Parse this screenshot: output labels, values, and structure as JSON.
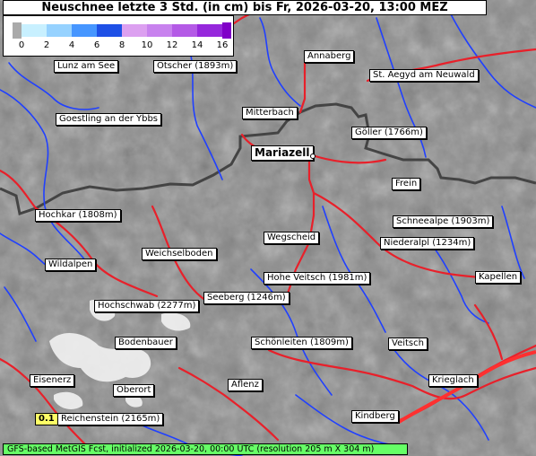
{
  "title": "Neuschnee letzte 3 Std. (in cm) bis Fr, 2026-03-20, 13:00 MEZ",
  "legend": {
    "ticks": [
      "0",
      "2",
      "4",
      "6",
      "8",
      "10",
      "12",
      "14",
      "16"
    ],
    "colors": [
      "#ffffff",
      "#c8f0ff",
      "#96d2ff",
      "#4696ff",
      "#1e50e6",
      "#dca0f0",
      "#c882ee",
      "#b45ae6",
      "#9628dc"
    ],
    "below_color": "#aaaaaa",
    "above_color": "#8000c8"
  },
  "places": [
    {
      "id": "annaberg",
      "name": "Annaberg"
    },
    {
      "id": "st-aegyd",
      "name": "St. Aegyd am Neuwald"
    },
    {
      "id": "lunz",
      "name": "Lunz am See"
    },
    {
      "id": "oetscher",
      "name": "Ötscher (1893m)"
    },
    {
      "id": "goestling",
      "name": "Goestling an der Ybbs"
    },
    {
      "id": "mitterbach",
      "name": "Mitterbach"
    },
    {
      "id": "goeller",
      "name": "Göller (1766m)"
    },
    {
      "id": "mariazell",
      "name": "Mariazell"
    },
    {
      "id": "frein",
      "name": "Frein"
    },
    {
      "id": "hochkar",
      "name": "Hochkar (1808m)"
    },
    {
      "id": "schneealpe",
      "name": "Schneealpe (1903m)"
    },
    {
      "id": "wegscheid",
      "name": "Wegscheid"
    },
    {
      "id": "niederalpl",
      "name": "Niederalpl (1234m)"
    },
    {
      "id": "weichselboden",
      "name": "Weichselboden"
    },
    {
      "id": "wildalpen",
      "name": "Wildalpen"
    },
    {
      "id": "hohe-veitsch",
      "name": "Hohe Veitsch (1981m)"
    },
    {
      "id": "kapellen",
      "name": "Kapellen"
    },
    {
      "id": "seeberg",
      "name": "Seeberg (1246m)"
    },
    {
      "id": "hochschwab",
      "name": "Hochschwab (2277m)"
    },
    {
      "id": "bodenbauer",
      "name": "Bodenbauer"
    },
    {
      "id": "schoenleiten",
      "name": "Schönleiten (1809m)"
    },
    {
      "id": "veitsch",
      "name": "Veitsch"
    },
    {
      "id": "eisenerz",
      "name": "Eisenerz"
    },
    {
      "id": "oberort",
      "name": "Oberort"
    },
    {
      "id": "aflenz",
      "name": "Aflenz"
    },
    {
      "id": "krieglach",
      "name": "Krieglach"
    },
    {
      "id": "reichenstein",
      "name": "Reichenstein (2165m)"
    },
    {
      "id": "kindberg",
      "name": "Kindberg"
    }
  ],
  "max_value": "0.1",
  "footer": "GFS-based MetGIS Fcst, initialized 2026-03-20, 00:00 UTC  (resolution 205 m X 304 m)",
  "colors": {
    "road": "#e8202a",
    "river": "#1e3cff",
    "border": "#444444",
    "terrain": "#8a8a8a",
    "snow": "#f4f4f4",
    "footer": "#66ff66",
    "badge": "#ffff66"
  }
}
